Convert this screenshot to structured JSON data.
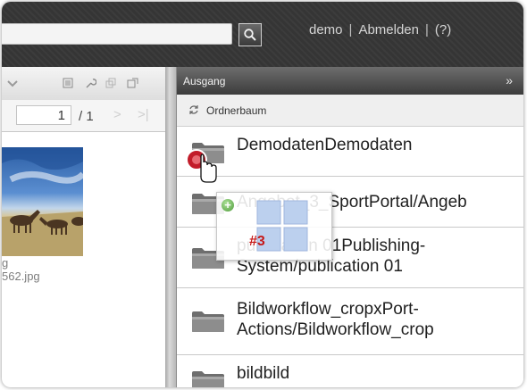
{
  "topbar": {
    "search_value": "",
    "search_icon": "search-icon",
    "user": "demo",
    "logout": "Abmelden",
    "help": "(?)",
    "separator": "|"
  },
  "left_pane": {
    "page_current": "1",
    "page_total": "/ 1",
    "next_icon": ">",
    "last_icon": ">|",
    "file_label_top": "g",
    "file_label_bottom": "562.jpg"
  },
  "panel": {
    "title": "Ausgang",
    "collapse_label": "»",
    "tree_icon": "refresh-icon",
    "tree_label": "Ordnerbaum",
    "folders": [
      {
        "name_line1": "DemodatenDemodaten",
        "name_line2": ""
      },
      {
        "name_line1": "Angebot_3_SportPortal/Angeb",
        "name_line2": ""
      },
      {
        "name_line1": "publication 01Publishing-",
        "name_line2": "System/publication 01"
      },
      {
        "name_line1": "Bildworkflow_cropxPort-",
        "name_line2": "Actions/Bildworkflow_crop"
      },
      {
        "name_line1": "bildbild",
        "name_line2": ""
      }
    ]
  },
  "drag": {
    "plus": "+",
    "count": "#3"
  },
  "colors": {
    "topbar_bg": "#353535",
    "panel_header_bg": "#4d4d4d",
    "count_red": "#c61818",
    "plus_green": "#4e9b3a",
    "drag_tile_blue": "#bcd0ee"
  }
}
